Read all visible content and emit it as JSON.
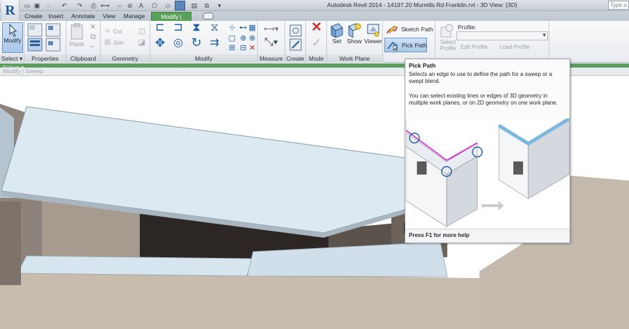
{
  "app": {
    "logo": "R",
    "window_title": "Autodesk Revit 2014 -   14197.20 Murrells Rd Franklin.rvt - 3D View: {3D}",
    "search_placeholder": "Type a k"
  },
  "tabs": [
    {
      "label": "Create"
    },
    {
      "label": "Insert"
    },
    {
      "label": "Annotate"
    },
    {
      "label": "View"
    },
    {
      "label": "Manage"
    },
    {
      "label": "Modify | Sweep",
      "active": true
    }
  ],
  "ribbon": {
    "panels": {
      "select": "Select ▾",
      "properties": "Properties",
      "clipboard": "Clipboard",
      "geometry": "Geometry",
      "modify": "Modify",
      "measure": "Measure",
      "create": "Create",
      "mode": "Mode",
      "work_plane": "Work Plane"
    },
    "buttons": {
      "modify": "Modify",
      "paste": "Paste",
      "cut": "Cut",
      "join": "Join",
      "set": "Set",
      "show": "Show",
      "viewer": "Viewer",
      "sketch_path": "Sketch Path",
      "pick_path": "Pick Path",
      "select_profile": "Select Profile",
      "edit_profile": "Edit Profile",
      "load_profile": "Load Profile",
      "profile_label": "Profile:"
    }
  },
  "options_bar": {
    "select_label": "Select ▾",
    "breadcrumb": "Modify | Sweep"
  },
  "tooltip": {
    "title": "Pick Path",
    "description": "Selects an edge to use to define the path for a sweep or a swept blend.",
    "detail": "You can select existing lines or edges of 3D geometry in multiple work planes, or on 2D geometry on one work plane.",
    "footer": "Press F1 for more help"
  },
  "colors": {
    "accent_tab": "#59a05b",
    "roof": "#dce9f1",
    "floor": "#c8bcad",
    "wall_dark": "#4e4540"
  }
}
